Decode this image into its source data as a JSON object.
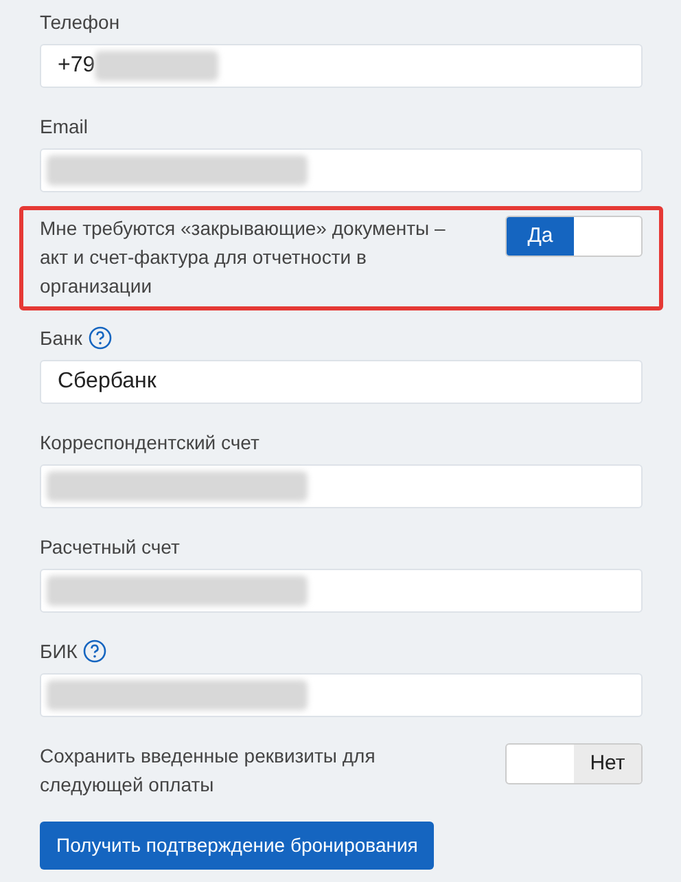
{
  "items": [
    {
      "kind": "field",
      "label": "Телефон",
      "help": false,
      "value": "+79",
      "blurred": true
    },
    {
      "kind": "field",
      "label": "Email",
      "help": false,
      "blurred": true
    },
    {
      "kind": "toggle",
      "label": "Мне требуются «закрывающие» документы – акт и счет-фактура для отчетности в организации",
      "highlighted": true,
      "on": true,
      "state_label": "Да"
    },
    {
      "kind": "field",
      "label": "Банк",
      "help": true,
      "value": "Сбербанк",
      "blurred": false
    },
    {
      "kind": "field",
      "label": "Корреспондентский счет",
      "help": false,
      "blurred": true
    },
    {
      "kind": "field",
      "label": "Расчетный счет",
      "help": false,
      "blurred": true
    },
    {
      "kind": "field",
      "label": "БИК",
      "help": true,
      "blurred": true
    },
    {
      "kind": "toggle",
      "label": "Сохранить введенные реквизиты для следующей оплаты",
      "highlighted": false,
      "on": false,
      "state_label": "Нет"
    }
  ],
  "submit": "Получить подтверждение бронирования"
}
